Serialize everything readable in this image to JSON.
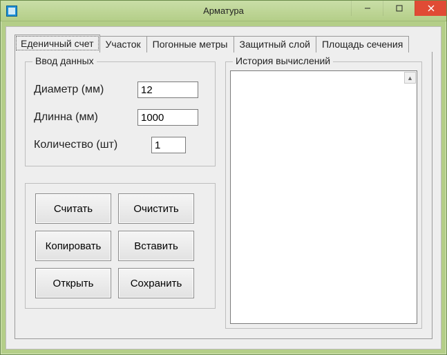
{
  "window": {
    "title": "Арматура"
  },
  "tabs": [
    {
      "label": "Еденичный счет",
      "active": true
    },
    {
      "label": "Участок",
      "active": false
    },
    {
      "label": "Погонные метры",
      "active": false
    },
    {
      "label": "Защитный слой",
      "active": false
    },
    {
      "label": "Площадь сечения",
      "active": false
    }
  ],
  "input_group": {
    "legend": "Ввод данных",
    "diameter_label": "Диаметр (мм)",
    "diameter_value": "12",
    "length_label": "Длинна   (мм)",
    "length_value": "1000",
    "count_label": "Количество (шт)",
    "count_value": "1"
  },
  "buttons": {
    "calc": "Считать",
    "clear": "Очистить",
    "copy": "Копировать",
    "paste": "Вставить",
    "open": "Открыть",
    "save": "Сохранить"
  },
  "history": {
    "legend": "История вычислений",
    "content": ""
  }
}
